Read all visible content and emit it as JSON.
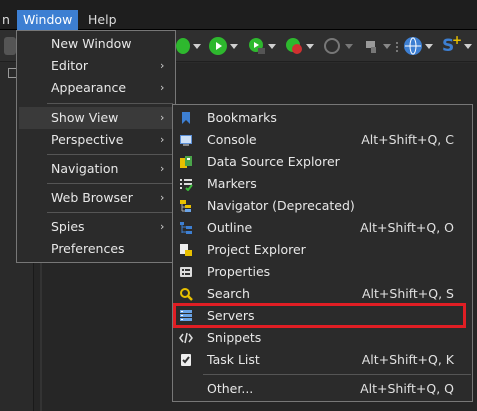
{
  "menubar": {
    "items": [
      {
        "label": "n",
        "active": false
      },
      {
        "label": "Window",
        "active": true
      },
      {
        "label": "Help",
        "active": false
      }
    ]
  },
  "window_menu": {
    "items": [
      {
        "label": "New Window",
        "submenu": false
      },
      {
        "label": "Editor",
        "submenu": true
      },
      {
        "label": "Appearance",
        "submenu": true
      },
      {
        "label": "Show View",
        "submenu": true,
        "selected": true
      },
      {
        "label": "Perspective",
        "submenu": true
      },
      {
        "label": "Navigation",
        "submenu": true
      },
      {
        "label": "Web Browser",
        "submenu": true
      },
      {
        "label": "Spies",
        "submenu": true
      },
      {
        "label": "Preferences",
        "submenu": false
      }
    ],
    "arrow": "›"
  },
  "show_view_menu": {
    "items": [
      {
        "label": "Bookmarks",
        "shortcut": "",
        "icon": "bookmark-icon"
      },
      {
        "label": "Console",
        "shortcut": "Alt+Shift+Q, C",
        "icon": "console-icon"
      },
      {
        "label": "Data Source Explorer",
        "shortcut": "",
        "icon": "data-source-icon"
      },
      {
        "label": "Markers",
        "shortcut": "",
        "icon": "markers-icon"
      },
      {
        "label": "Navigator (Deprecated)",
        "shortcut": "",
        "icon": "navigator-icon"
      },
      {
        "label": "Outline",
        "shortcut": "Alt+Shift+Q, O",
        "icon": "outline-icon"
      },
      {
        "label": "Project Explorer",
        "shortcut": "",
        "icon": "project-explorer-icon"
      },
      {
        "label": "Properties",
        "shortcut": "",
        "icon": "properties-icon"
      },
      {
        "label": "Search",
        "shortcut": "Alt+Shift+Q, S",
        "icon": "search-icon"
      },
      {
        "label": "Servers",
        "shortcut": "",
        "icon": "servers-icon",
        "highlighted": true
      },
      {
        "label": "Snippets",
        "shortcut": "",
        "icon": "snippets-icon"
      },
      {
        "label": "Task List",
        "shortcut": "Alt+Shift+Q, K",
        "icon": "task-list-icon"
      },
      {
        "label": "Other...",
        "shortcut": "Alt+Shift+Q, Q",
        "icon": ""
      }
    ]
  },
  "colors": {
    "menu_active": "#3d7fd2",
    "highlight_border": "#e01e24",
    "run_green": "#2eb82e",
    "stop_red": "#d03030"
  }
}
